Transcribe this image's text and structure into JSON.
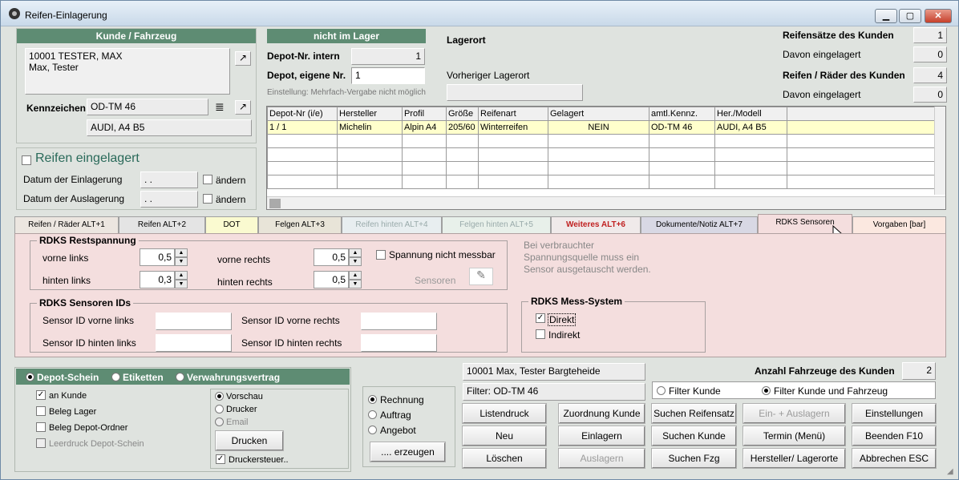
{
  "window": {
    "title": "Reifen-Einlagerung",
    "min": "▁",
    "max": "▢",
    "close": "✕"
  },
  "kunde": {
    "header": "Kunde / Fahrzeug",
    "address_line1": "10001 TESTER, MAX",
    "address_line2": "Max, Tester",
    "kennzeichen_label": "Kennzeichen",
    "kennzeichen": "OD-TM 46",
    "fahrzeug": "AUDI, A4 B5"
  },
  "eingelagert": {
    "title": "Reifen eingelagert",
    "datum_ein_label": "Datum der Einlagerung",
    "datum_ein": ". .",
    "datum_aus_label": "Datum der Auslagerung",
    "datum_aus": ". .",
    "aendern": "ändern"
  },
  "depot": {
    "header": "nicht im Lager",
    "intern_label": "Depot-Nr. intern",
    "intern": "1",
    "eigene_label": "Depot, eigene Nr.",
    "eigene": "1",
    "hint": "Einstellung: Mehrfach-Vergabe nicht möglich",
    "lagerort_label": "Lagerort",
    "vorheriger_label": "Vorheriger Lagerort"
  },
  "stats": {
    "saetze_label": "Reifensätze des Kunden",
    "saetze": "1",
    "davon1_label": "Davon eingelagert",
    "davon1": "0",
    "raeder_label": "Reifen / Räder des Kunden",
    "raeder": "4",
    "davon2_label": "Davon eingelagert",
    "davon2": "0"
  },
  "grid": {
    "columns": [
      "Depot-Nr (i/e)",
      "Hersteller",
      "Profil",
      "Größe",
      "Reifenart",
      "Gelagert",
      "amtl.Kennz.",
      "Her./Modell"
    ],
    "rows": [
      [
        "1 / 1",
        "Michelin",
        "Alpin A4",
        "205/60",
        "Winterreifen",
        "NEIN",
        "OD-TM 46",
        "AUDI, A4 B5"
      ]
    ]
  },
  "tabs": [
    "Reifen / Räder ALT+1",
    "Reifen ALT+2",
    "DOT",
    "Felgen ALT+3",
    "Reifen hinten ALT+4",
    "Felgen hinten ALT+5",
    "Weiteres ALT+6",
    "Dokumente/Notiz ALT+7",
    "RDKS Sensoren",
    "Vorgaben [bar]"
  ],
  "rdks": {
    "rest_title": "RDKS Restspannung",
    "vl_label": "vorne links",
    "vl": "0,5",
    "hl_label": "hinten links",
    "hl": "0,3",
    "vr_label": "vorne rechts",
    "vr": "0,5",
    "hr_label": "hinten rechts",
    "hr": "0,5",
    "nicht_messbar": "Spannung nicht messbar",
    "sensoren": "Sensoren",
    "note": "Bei verbrauchter Spannungsquelle muss ein Sensor ausgetauscht werden.",
    "ids_title": "RDKS Sensoren IDs",
    "id_vl": "Sensor ID vorne links",
    "id_hl": "Sensor ID hinten links",
    "id_vr": "Sensor ID vorne rechts",
    "id_hr": "Sensor ID hinten rechts",
    "mess_title": "RDKS Mess-System",
    "direkt": "Direkt",
    "indirekt": "Indirekt"
  },
  "druck": {
    "depot_schein": "Depot-Schein",
    "etiketten": "Etiketten",
    "verwahrung": "Verwahrungsvertrag",
    "an_kunde": "an Kunde",
    "beleg_lager": "Beleg Lager",
    "beleg_ordner": "Beleg Depot-Ordner",
    "leerdruck": "Leerdruck Depot-Schein",
    "vorschau": "Vorschau",
    "drucker": "Drucker",
    "email": "Email",
    "drucken": "Drucken",
    "druckersteuer": "Druckersteuer..",
    "rechnung": "Rechnung",
    "auftrag": "Auftrag",
    "angebot": "Angebot",
    "erzeugen": ".... erzeugen"
  },
  "summary": {
    "kunde": "10001 Max, Tester Bargteheide",
    "filter": "Filter: OD-TM 46",
    "anzahl_label": "Anzahl Fahrzeuge des Kunden",
    "anzahl": "2",
    "filter_kunde": "Filter Kunde",
    "filter_kunde_fzg": "Filter Kunde und Fahrzeug"
  },
  "buttons": {
    "listendruck": "Listendruck",
    "zuordnung": "Zuordnung Kunde",
    "suchen_satz": "Suchen Reifensatz",
    "ein_aus": "Ein- + Auslagern",
    "einstellungen": "Einstellungen",
    "neu": "Neu",
    "einlagern": "Einlagern",
    "suchen_kunde": "Suchen Kunde",
    "termin": "Termin (Menü)",
    "beenden": "Beenden F10",
    "loeschen": "Löschen",
    "auslagern": "Auslagern",
    "suchen_fzg": "Suchen Fzg",
    "hersteller": "Hersteller/ Lagerorte",
    "abbrechen": "Abbrechen ESC"
  }
}
